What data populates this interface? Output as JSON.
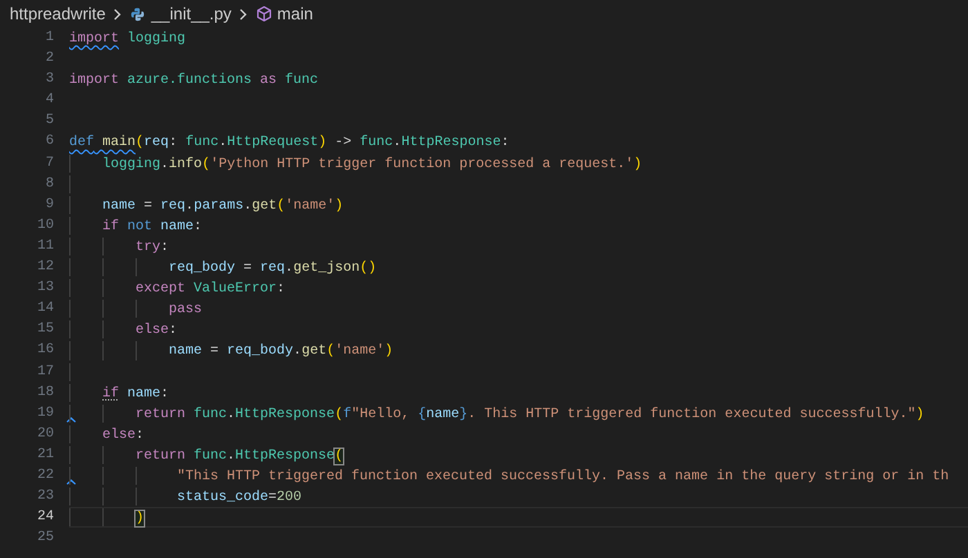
{
  "breadcrumb": [
    {
      "kind": "folder",
      "label": "httpreadwrite"
    },
    {
      "kind": "python-file",
      "label": "__init__.py"
    },
    {
      "kind": "function",
      "label": "main"
    }
  ],
  "lines": [
    {
      "number": "1",
      "current": false,
      "marker": false,
      "tokens": [
        {
          "kind": "keyword",
          "text": "import",
          "squiggle": true
        },
        {
          "kind": "type",
          "text": " logging"
        }
      ]
    },
    {
      "number": "2",
      "current": false,
      "marker": false
    },
    {
      "number": "3",
      "current": false,
      "marker": false,
      "tokens": [
        {
          "kind": "keyword",
          "text": "import"
        },
        {
          "kind": "type",
          "text": " azure.functions"
        },
        {
          "kind": "keyword",
          "text": " as"
        },
        {
          "kind": "type",
          "text": " func"
        }
      ]
    },
    {
      "number": "4",
      "current": false,
      "marker": false
    },
    {
      "number": "5",
      "current": false,
      "marker": false
    },
    {
      "number": "6",
      "current": false,
      "marker": false,
      "tokens": [
        {
          "kind": "storage",
          "text": "def",
          "squiggle": true
        },
        {
          "kind": "function",
          "text": " main",
          "squiggle": true
        },
        {
          "kind": "bracket",
          "text": "("
        },
        {
          "kind": "variable",
          "text": "req"
        },
        {
          "kind": "plain",
          "text": ":"
        },
        {
          "kind": "type",
          "text": " func"
        },
        {
          "kind": "plain",
          "text": "."
        },
        {
          "kind": "type",
          "text": "HttpRequest"
        },
        {
          "kind": "bracket",
          "text": ")"
        },
        {
          "kind": "plain",
          "text": " ->"
        },
        {
          "kind": "type",
          "text": " func"
        },
        {
          "kind": "plain",
          "text": "."
        },
        {
          "kind": "type",
          "text": "HttpResponse"
        },
        {
          "kind": "plain",
          "text": ":"
        }
      ]
    },
    {
      "number": "7",
      "current": false,
      "marker": false,
      "tokens": [
        {
          "kind": "type",
          "text": "    logging"
        },
        {
          "kind": "plain",
          "text": "."
        },
        {
          "kind": "function",
          "text": "info"
        },
        {
          "kind": "bracket",
          "text": "("
        },
        {
          "kind": "string",
          "text": "'Python HTTP trigger function processed a request.'"
        },
        {
          "kind": "bracket",
          "text": ")"
        }
      ]
    },
    {
      "number": "8",
      "current": false,
      "marker": false
    },
    {
      "number": "9",
      "current": false,
      "marker": false,
      "tokens": [
        {
          "kind": "variable",
          "text": "    name"
        },
        {
          "kind": "plain",
          "text": " ="
        },
        {
          "kind": "variable",
          "text": " req"
        },
        {
          "kind": "plain",
          "text": "."
        },
        {
          "kind": "variable",
          "text": "params"
        },
        {
          "kind": "plain",
          "text": "."
        },
        {
          "kind": "function",
          "text": "get"
        },
        {
          "kind": "bracket",
          "text": "("
        },
        {
          "kind": "string",
          "text": "'name'"
        },
        {
          "kind": "bracket",
          "text": ")"
        }
      ]
    },
    {
      "number": "10",
      "current": false,
      "marker": false,
      "tokens": [
        {
          "kind": "keyword",
          "text": "    if"
        },
        {
          "kind": "storage",
          "text": " not"
        },
        {
          "kind": "variable",
          "text": " name"
        },
        {
          "kind": "plain",
          "text": ":"
        }
      ]
    },
    {
      "number": "11",
      "current": false,
      "marker": false,
      "tokens": [
        {
          "kind": "keyword",
          "text": "        try"
        },
        {
          "kind": "plain",
          "text": ":"
        }
      ]
    },
    {
      "number": "12",
      "current": false,
      "marker": false,
      "tokens": [
        {
          "kind": "variable",
          "text": "            req_body"
        },
        {
          "kind": "plain",
          "text": " ="
        },
        {
          "kind": "variable",
          "text": " req"
        },
        {
          "kind": "plain",
          "text": "."
        },
        {
          "kind": "function",
          "text": "get_json"
        },
        {
          "kind": "bracket",
          "text": "()"
        }
      ]
    },
    {
      "number": "13",
      "current": false,
      "marker": false,
      "tokens": [
        {
          "kind": "keyword",
          "text": "        except"
        },
        {
          "kind": "type",
          "text": " ValueError"
        },
        {
          "kind": "plain",
          "text": ":"
        }
      ]
    },
    {
      "number": "14",
      "current": false,
      "marker": false,
      "tokens": [
        {
          "kind": "keyword",
          "text": "            pass"
        }
      ]
    },
    {
      "number": "15",
      "current": false,
      "marker": false,
      "tokens": [
        {
          "kind": "keyword",
          "text": "        else"
        },
        {
          "kind": "plain",
          "text": ":"
        }
      ]
    },
    {
      "number": "16",
      "current": false,
      "marker": false,
      "tokens": [
        {
          "kind": "variable",
          "text": "            name"
        },
        {
          "kind": "plain",
          "text": " ="
        },
        {
          "kind": "variable",
          "text": " req_body"
        },
        {
          "kind": "plain",
          "text": "."
        },
        {
          "kind": "function",
          "text": "get"
        },
        {
          "kind": "bracket",
          "text": "("
        },
        {
          "kind": "string",
          "text": "'name'"
        },
        {
          "kind": "bracket",
          "text": ")"
        }
      ]
    },
    {
      "number": "17",
      "current": false,
      "marker": false
    },
    {
      "number": "18",
      "current": false,
      "marker": false,
      "tokens": [
        {
          "kind": "keyword",
          "text": "    if",
          "dotted": true
        },
        {
          "kind": "variable",
          "text": " name"
        },
        {
          "kind": "plain",
          "text": ":"
        }
      ]
    },
    {
      "number": "19",
      "current": false,
      "marker": true,
      "tokens": [
        {
          "kind": "keyword",
          "text": "        return"
        },
        {
          "kind": "type",
          "text": " func"
        },
        {
          "kind": "plain",
          "text": "."
        },
        {
          "kind": "type",
          "text": "HttpResponse"
        },
        {
          "kind": "bracket",
          "text": "("
        },
        {
          "kind": "storage",
          "text": "f"
        },
        {
          "kind": "string",
          "text": "\"Hello, "
        },
        {
          "kind": "storage",
          "text": "{"
        },
        {
          "kind": "variable",
          "text": "name"
        },
        {
          "kind": "storage",
          "text": "}"
        },
        {
          "kind": "string",
          "text": ". This HTTP triggered function executed successfully.\""
        },
        {
          "kind": "bracket",
          "text": ")"
        }
      ]
    },
    {
      "number": "20",
      "current": false,
      "marker": false,
      "tokens": [
        {
          "kind": "keyword",
          "text": "    else"
        },
        {
          "kind": "plain",
          "text": ":"
        }
      ]
    },
    {
      "number": "21",
      "current": false,
      "marker": false,
      "tokens": [
        {
          "kind": "keyword",
          "text": "        return"
        },
        {
          "kind": "type",
          "text": " func"
        },
        {
          "kind": "plain",
          "text": "."
        },
        {
          "kind": "type",
          "text": "HttpResponse"
        },
        {
          "kind": "bracket",
          "text": "(",
          "matched": true
        }
      ]
    },
    {
      "number": "22",
      "current": false,
      "marker": true,
      "tokens": [
        {
          "kind": "string",
          "text": "             \"This HTTP triggered function executed successfully. Pass a name in the query string or in th"
        }
      ]
    },
    {
      "number": "23",
      "current": false,
      "marker": false,
      "tokens": [
        {
          "kind": "variable",
          "text": "             status_code"
        },
        {
          "kind": "plain",
          "text": "="
        },
        {
          "kind": "number",
          "text": "200"
        }
      ]
    },
    {
      "number": "24",
      "current": true,
      "marker": false,
      "tokens": [
        {
          "kind": "bracket",
          "text": "        )",
          "matched": true
        }
      ]
    },
    {
      "number": "25",
      "current": false,
      "marker": false
    }
  ]
}
